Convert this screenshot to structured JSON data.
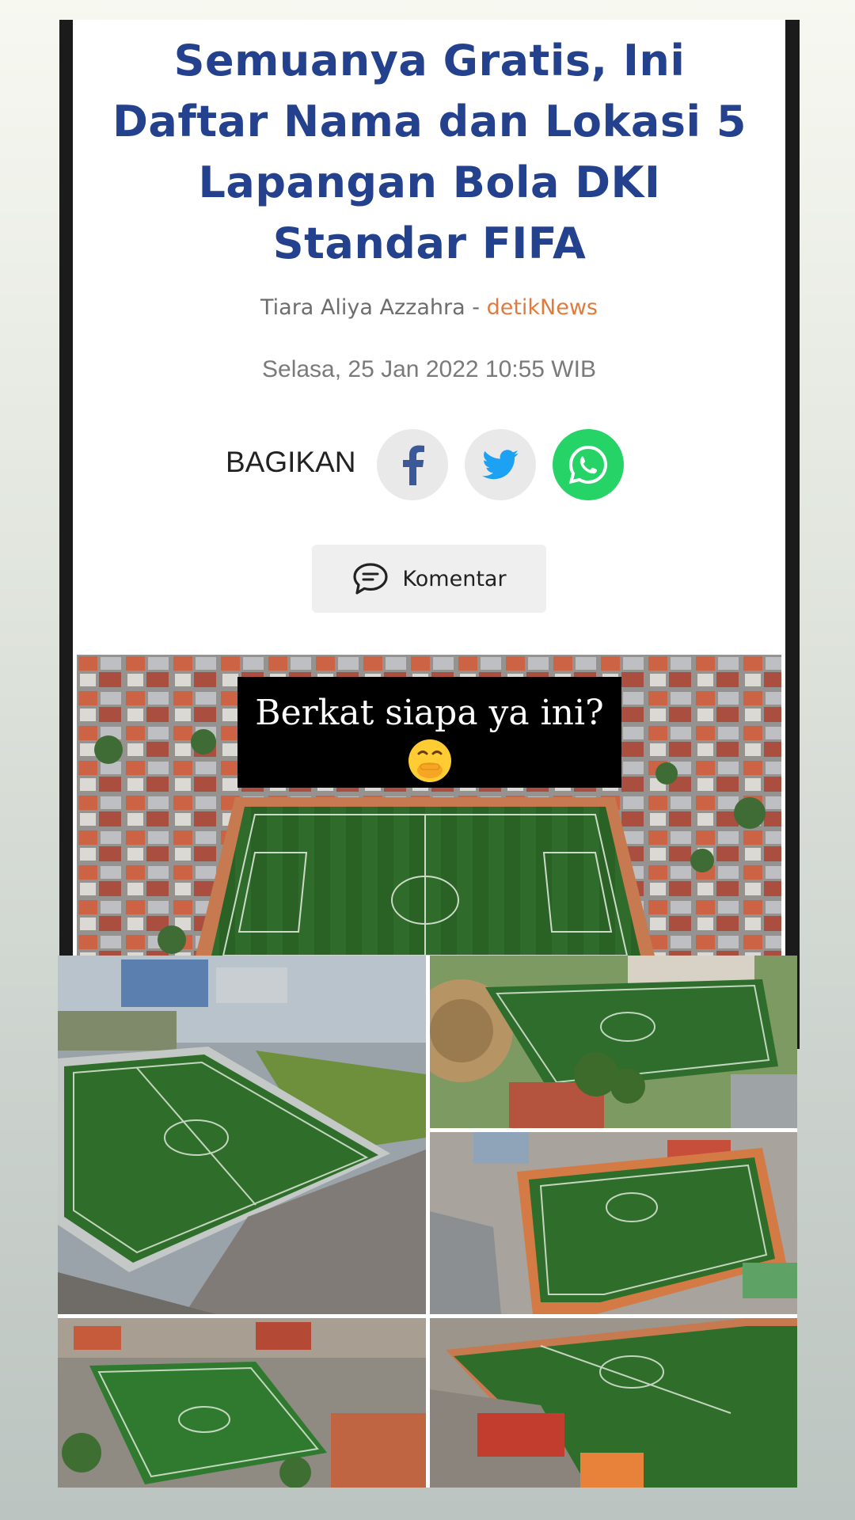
{
  "article": {
    "headline": "Semuanya Gratis, Ini Daftar Nama dan Lokasi 5 Lapangan Bola DKI Standar FIFA",
    "author": "Tiara Aliya Azzahra",
    "separator": " - ",
    "source": "detikNews",
    "date": "Selasa, 25 Jan 2022 10:55 WIB"
  },
  "share": {
    "label": "BAGIKAN",
    "buttons": [
      {
        "name": "facebook",
        "icon": "facebook-icon",
        "color": "#3b5998"
      },
      {
        "name": "twitter",
        "icon": "twitter-icon",
        "color": "#1da1f2"
      },
      {
        "name": "whatsapp",
        "icon": "whatsapp-icon",
        "color": "#25d366"
      }
    ]
  },
  "comment": {
    "label": "Komentar",
    "icon": "comment-icon"
  },
  "overlay": {
    "caption": "Berkat siapa ya ini?",
    "emoji": "face-with-hand-over-mouth-icon"
  },
  "colors": {
    "headline": "#24418d",
    "source": "#e07b3d",
    "pitch": "#2f6b2b"
  }
}
